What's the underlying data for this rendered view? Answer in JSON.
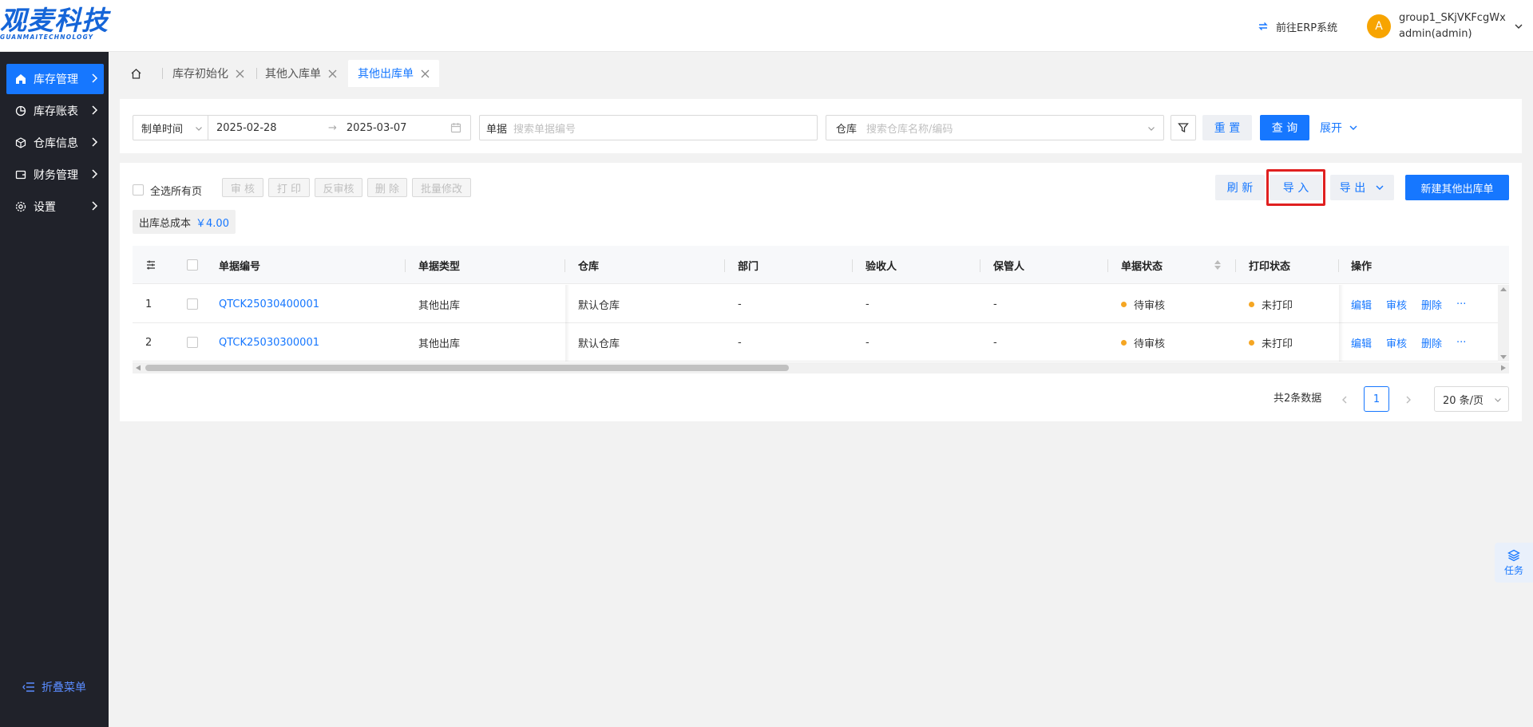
{
  "brand": {
    "name": "观麦科技",
    "sub": "GUANMAITECHNOLOGY"
  },
  "header": {
    "erp_link": "前往ERP系统",
    "user_initial": "A",
    "user_group": "group1_SKjVKFcgWx",
    "user_account": "admin(admin)"
  },
  "sidebar": {
    "items": [
      {
        "label": "库存管理",
        "icon": "home-icon",
        "active": true
      },
      {
        "label": "库存账表",
        "icon": "pie-chart-icon",
        "active": false
      },
      {
        "label": "仓库信息",
        "icon": "cube-icon",
        "active": false
      },
      {
        "label": "财务管理",
        "icon": "wallet-icon",
        "active": false
      },
      {
        "label": "设置",
        "icon": "gear-icon",
        "active": false
      }
    ],
    "collapse_label": "折叠菜单"
  },
  "tabs": [
    {
      "label": "库存初始化",
      "active": false
    },
    {
      "label": "其他入库单",
      "active": false
    },
    {
      "label": "其他出库单",
      "active": true
    }
  ],
  "filter": {
    "date_type": "制单时间",
    "date_start": "2025-02-28",
    "date_end": "2025-03-07",
    "doc_label": "单据",
    "doc_placeholder": "搜索单据编号",
    "warehouse_label": "仓库",
    "warehouse_placeholder": "搜索仓库名称/编码",
    "reset": "重 置",
    "query": "查 询",
    "expand": "展开"
  },
  "toolbar": {
    "select_all": "全选所有页",
    "audit": "审 核",
    "print": "打 印",
    "unaudit": "反审核",
    "delete": "删 除",
    "batch_edit": "批量修改",
    "refresh": "刷 新",
    "import": "导 入",
    "export": "导 出",
    "new": "新建其他出库单"
  },
  "summary": {
    "label": "出库总成本",
    "value": "￥4.00"
  },
  "table": {
    "columns": [
      "单据编号",
      "单据类型",
      "仓库",
      "部门",
      "验收人",
      "保管人",
      "单据状态",
      "打印状态",
      "操作"
    ],
    "rows": [
      {
        "index": "1",
        "doc_no": "QTCK25030400001",
        "type": "其他出库",
        "warehouse": "默认仓库",
        "dept": "-",
        "receiver": "-",
        "keeper": "-",
        "status": "待审核",
        "print_status": "未打印"
      },
      {
        "index": "2",
        "doc_no": "QTCK25030300001",
        "type": "其他出库",
        "warehouse": "默认仓库",
        "dept": "-",
        "receiver": "-",
        "keeper": "-",
        "status": "待审核",
        "print_status": "未打印"
      }
    ],
    "actions": {
      "edit": "编辑",
      "audit": "审核",
      "delete": "删除",
      "more": "···"
    }
  },
  "pagination": {
    "total": "共2条数据",
    "page": "1",
    "page_size": "20 条/页"
  },
  "task_float": {
    "label": "任务"
  },
  "colors": {
    "primary": "#1677ff",
    "sidebar_bg": "#20222a",
    "status_dot": "#f5a623",
    "avatar": "#f7a400",
    "highlight": "#e02020"
  }
}
